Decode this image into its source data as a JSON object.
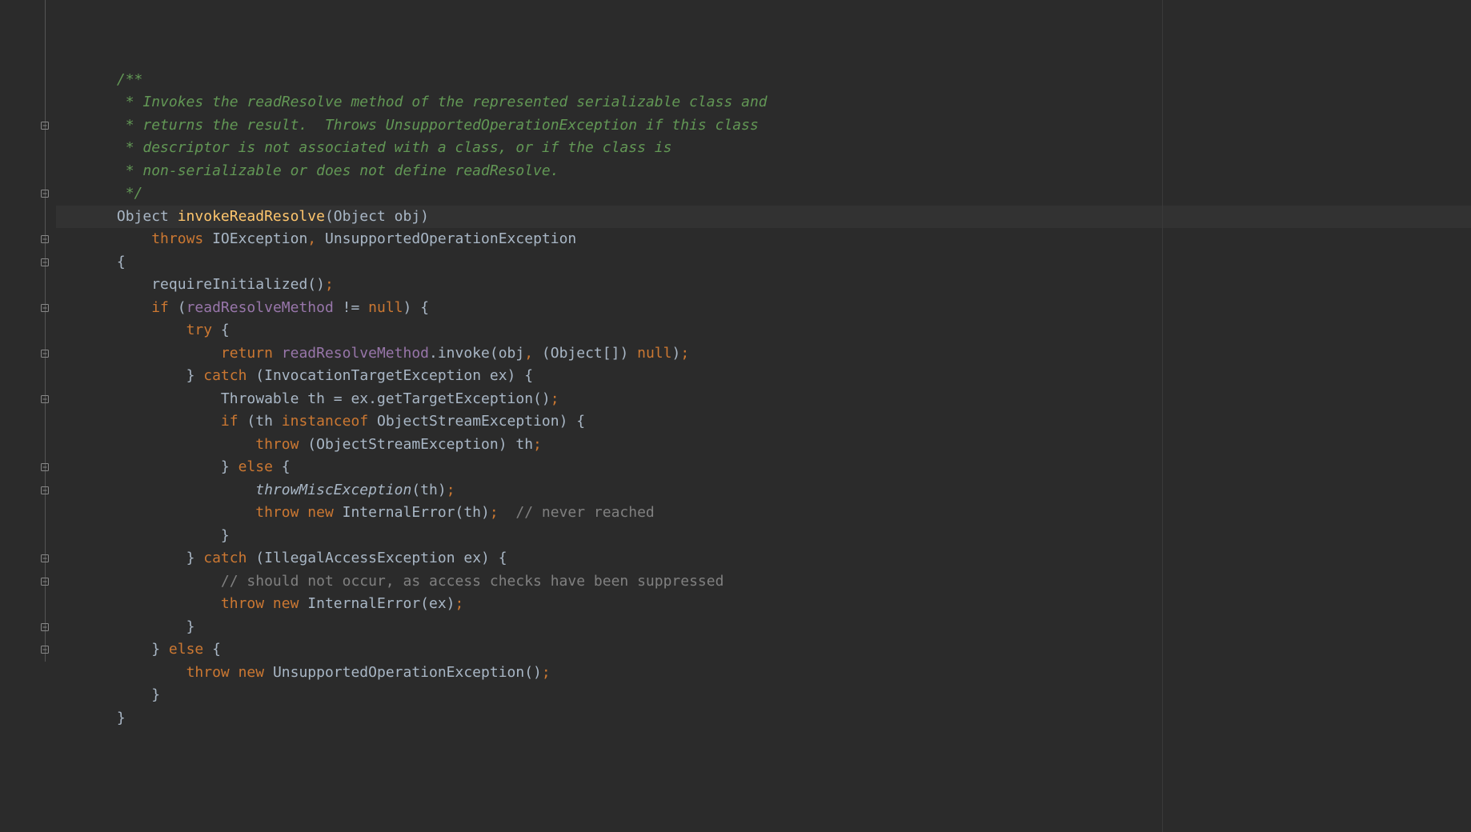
{
  "indent_unit": "    ",
  "lines": [
    {
      "indent": 1,
      "fold": "none",
      "tokens": [
        {
          "t": "/**",
          "cls": "c"
        }
      ]
    },
    {
      "indent": 1,
      "fold": "none",
      "tokens": [
        {
          "t": " * Invokes the readResolve method of the represented serializable class and",
          "cls": "c"
        }
      ]
    },
    {
      "indent": 1,
      "fold": "none",
      "tokens": [
        {
          "t": " * returns the result.  Throws UnsupportedOperationException if this class",
          "cls": "c"
        }
      ]
    },
    {
      "indent": 1,
      "fold": "none",
      "tokens": [
        {
          "t": " * descriptor is not associated with a class, or if the class is",
          "cls": "c"
        }
      ]
    },
    {
      "indent": 1,
      "fold": "none",
      "tokens": [
        {
          "t": " * non-serializable or does not define readResolve.",
          "cls": "c"
        }
      ]
    },
    {
      "indent": 1,
      "fold": "end",
      "tokens": [
        {
          "t": " */",
          "cls": "c"
        }
      ]
    },
    {
      "indent": 1,
      "fold": "none",
      "hl": true,
      "tokens": [
        {
          "t": "Object ",
          "cls": "id"
        },
        {
          "t": "invokeReadResolve",
          "cls": "fn"
        },
        {
          "t": "(Object obj)",
          "cls": "id"
        }
      ]
    },
    {
      "indent": 2,
      "fold": "none",
      "tokens": [
        {
          "t": "throws ",
          "cls": "k"
        },
        {
          "t": "IOException",
          "cls": "id"
        },
        {
          "t": ", ",
          "cls": "k"
        },
        {
          "t": "UnsupportedOperationException",
          "cls": "id"
        }
      ]
    },
    {
      "indent": 1,
      "fold": "start",
      "tokens": [
        {
          "t": "{",
          "cls": "p"
        }
      ]
    },
    {
      "indent": 2,
      "fold": "none",
      "tokens": [
        {
          "t": "requireInitialized()",
          "cls": "id"
        },
        {
          "t": ";",
          "cls": "k"
        }
      ]
    },
    {
      "indent": 2,
      "fold": "start",
      "tokens": [
        {
          "t": "if ",
          "cls": "k"
        },
        {
          "t": "(",
          "cls": "p"
        },
        {
          "t": "readResolveMethod",
          "cls": "fld"
        },
        {
          "t": " != ",
          "cls": "id"
        },
        {
          "t": "null",
          "cls": "k"
        },
        {
          "t": ") {",
          "cls": "p"
        }
      ]
    },
    {
      "indent": 3,
      "fold": "start",
      "tokens": [
        {
          "t": "try ",
          "cls": "k"
        },
        {
          "t": "{",
          "cls": "p"
        }
      ]
    },
    {
      "indent": 4,
      "fold": "none",
      "tokens": [
        {
          "t": "return ",
          "cls": "k"
        },
        {
          "t": "readResolveMethod",
          "cls": "fld"
        },
        {
          "t": ".invoke(obj",
          "cls": "id"
        },
        {
          "t": ", ",
          "cls": "k"
        },
        {
          "t": "(Object[]) ",
          "cls": "id"
        },
        {
          "t": "null",
          "cls": "k"
        },
        {
          "t": ")",
          "cls": "p"
        },
        {
          "t": ";",
          "cls": "k"
        }
      ]
    },
    {
      "indent": 3,
      "fold": "mid",
      "tokens": [
        {
          "t": "} ",
          "cls": "p"
        },
        {
          "t": "catch ",
          "cls": "k"
        },
        {
          "t": "(InvocationTargetException ex) {",
          "cls": "id"
        }
      ]
    },
    {
      "indent": 4,
      "fold": "none",
      "tokens": [
        {
          "t": "Throwable th = ex.getTargetException()",
          "cls": "id"
        },
        {
          "t": ";",
          "cls": "k"
        }
      ]
    },
    {
      "indent": 4,
      "fold": "start",
      "tokens": [
        {
          "t": "if ",
          "cls": "k"
        },
        {
          "t": "(th ",
          "cls": "id"
        },
        {
          "t": "instanceof ",
          "cls": "k"
        },
        {
          "t": "ObjectStreamException) {",
          "cls": "id"
        }
      ]
    },
    {
      "indent": 5,
      "fold": "none",
      "tokens": [
        {
          "t": "throw ",
          "cls": "k"
        },
        {
          "t": "(ObjectStreamException) th",
          "cls": "id"
        },
        {
          "t": ";",
          "cls": "k"
        }
      ]
    },
    {
      "indent": 4,
      "fold": "mid",
      "tokens": [
        {
          "t": "} ",
          "cls": "p"
        },
        {
          "t": "else ",
          "cls": "k"
        },
        {
          "t": "{",
          "cls": "p"
        }
      ]
    },
    {
      "indent": 5,
      "fold": "none",
      "tokens": [
        {
          "t": "throwMiscException",
          "cls": "mi"
        },
        {
          "t": "(th)",
          "cls": "id"
        },
        {
          "t": ";",
          "cls": "k"
        }
      ]
    },
    {
      "indent": 5,
      "fold": "none",
      "tokens": [
        {
          "t": "throw new ",
          "cls": "k"
        },
        {
          "t": "InternalError(th)",
          "cls": "id"
        },
        {
          "t": ";  ",
          "cls": "k"
        },
        {
          "t": "// never reached",
          "cls": "lc"
        }
      ]
    },
    {
      "indent": 4,
      "fold": "end",
      "tokens": [
        {
          "t": "}",
          "cls": "p"
        }
      ]
    },
    {
      "indent": 3,
      "fold": "mid",
      "tokens": [
        {
          "t": "} ",
          "cls": "p"
        },
        {
          "t": "catch ",
          "cls": "k"
        },
        {
          "t": "(IllegalAccessException ex) {",
          "cls": "id"
        }
      ]
    },
    {
      "indent": 4,
      "fold": "none",
      "tokens": [
        {
          "t": "// should not occur, as access checks have been suppressed",
          "cls": "lc"
        }
      ]
    },
    {
      "indent": 4,
      "fold": "none",
      "tokens": [
        {
          "t": "throw new ",
          "cls": "k"
        },
        {
          "t": "InternalError(ex)",
          "cls": "id"
        },
        {
          "t": ";",
          "cls": "k"
        }
      ]
    },
    {
      "indent": 3,
      "fold": "end",
      "tokens": [
        {
          "t": "}",
          "cls": "p"
        }
      ]
    },
    {
      "indent": 2,
      "fold": "mid",
      "tokens": [
        {
          "t": "} ",
          "cls": "p"
        },
        {
          "t": "else ",
          "cls": "k"
        },
        {
          "t": "{",
          "cls": "p"
        }
      ]
    },
    {
      "indent": 3,
      "fold": "none",
      "tokens": [
        {
          "t": "throw new ",
          "cls": "k"
        },
        {
          "t": "UnsupportedOperationException()",
          "cls": "id"
        },
        {
          "t": ";",
          "cls": "k"
        }
      ]
    },
    {
      "indent": 2,
      "fold": "end",
      "tokens": [
        {
          "t": "}",
          "cls": "p"
        }
      ]
    },
    {
      "indent": 1,
      "fold": "end",
      "tokens": [
        {
          "t": "}",
          "cls": "p"
        }
      ]
    }
  ]
}
